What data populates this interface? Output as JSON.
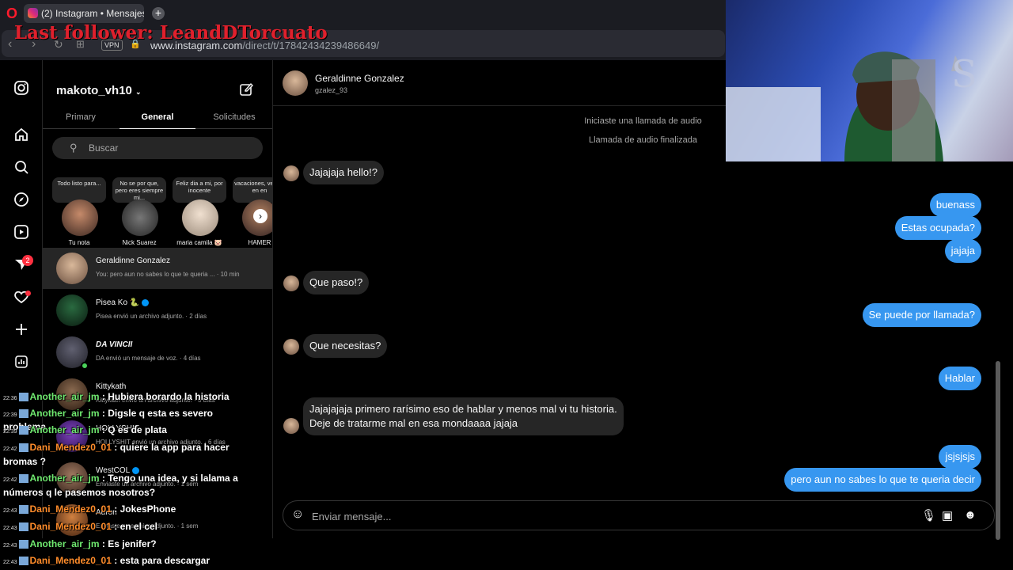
{
  "browser": {
    "tab_title": "(2) Instagram • Mensajes",
    "new_tab": "+",
    "vpn": "VPN",
    "url_host": "www.instagram.com",
    "url_path": "/direct/t/17842434239486649/",
    "opera": "O"
  },
  "overlay": {
    "last_follower": "Last follower: LeandDTorcuato"
  },
  "sidebar": {
    "notifications_badge": "2"
  },
  "inbox": {
    "username": "makoto_vh10",
    "tabs": [
      "Primary",
      "General",
      "Solicitudes"
    ],
    "search_placeholder": "Buscar",
    "notes": [
      {
        "text": "Todo listo para...",
        "name": "Tu nota"
      },
      {
        "text": "No se por que, pero eres siempre mi...",
        "name": "Nick Suarez"
      },
      {
        "text": "Feliz dia a mi, por inocente",
        "name": "maria camila 🐷"
      },
      {
        "text": "vacaciones, vemos en en",
        "name": "HAMER"
      }
    ],
    "conversations": [
      {
        "name": "Geraldinne Gonzalez",
        "preview": "You: pero aun no sabes lo que te queria ... · 10 min"
      },
      {
        "name": "Pisea Ko 🐍",
        "preview": "Pisea envió un archivo adjunto. · 2 días"
      },
      {
        "name": "DA VINCII",
        "preview": "DA envió un mensaje de voz. · 4 días"
      },
      {
        "name": "Kittykath",
        "preview": "Kittykath envió un archivo adjunto. · 5 días"
      },
      {
        "name": "HOLLYSHIT",
        "preview": "HOLLYSHIT envió un archivo adjunto. · 6 días"
      },
      {
        "name": "WestCOL",
        "preview": "Enviaste un archivo adjunto. · 1 sem"
      },
      {
        "name": "Auron",
        "preview": "Enviaste un archivo adjunto. · 1 sem"
      }
    ]
  },
  "chat": {
    "contact_name": "Geraldinne Gonzalez",
    "contact_handle": "gzalez_93",
    "system": [
      "Iniciaste una llamada de audio",
      "Llamada de audio finalizada"
    ],
    "messages": [
      {
        "dir": "recv",
        "text": "Jajajaja hello!?"
      },
      {
        "dir": "sent",
        "text": "buenass"
      },
      {
        "dir": "sent",
        "text": "Estas ocupada?"
      },
      {
        "dir": "sent",
        "text": "jajaja"
      },
      {
        "dir": "recv",
        "text": "Que paso!?"
      },
      {
        "dir": "sent",
        "text": "Se puede por llamada?"
      },
      {
        "dir": "recv",
        "text": "Que necesitas?"
      },
      {
        "dir": "sent",
        "text": "Hablar"
      },
      {
        "dir": "recv",
        "text": "Jajajajaja primero rarísimo eso de hablar y menos mal vi tu historia."
      },
      {
        "dir": "recv",
        "text": "Deje de tratarme mal en esa mondaaaa jajaja"
      },
      {
        "dir": "sent",
        "text": "jsjsjsjs"
      },
      {
        "dir": "sent",
        "text": "pero aun no sabes lo que te queria decir"
      }
    ],
    "composer_placeholder": "Enviar mensaje..."
  },
  "stream_chat": [
    {
      "time": "22:36",
      "user": "Another_air_jm",
      "text": ": Hubiera borardo la historia",
      "color": "green"
    },
    {
      "time": "22:39",
      "user": "Another_air_jm",
      "text": ": Digsle q esta es severo problema",
      "color": "green"
    },
    {
      "time": "22:39",
      "user": "Another_air_jm",
      "text": ": Q es de plata",
      "color": "green"
    },
    {
      "time": "22:42",
      "user": "Dani_Mendez0_01",
      "text": ": quiere la app para hacer",
      "color": "orange"
    },
    {
      "time": "",
      "user": "",
      "text": "bromas ?",
      "color": "none"
    },
    {
      "time": "22:42",
      "user": "Another_air_jm",
      "text": ": Tengo una idea, y si lalama a",
      "color": "green"
    },
    {
      "time": "",
      "user": "",
      "text": "números q le pasemos nosotros?",
      "color": "none"
    },
    {
      "time": "22:43",
      "user": "Dani_Mendez0_01",
      "text": ": JokesPhone",
      "color": "orange"
    },
    {
      "time": "22:43",
      "user": "Dani_Mendez0_01",
      "text": ": en el cel",
      "color": "orange"
    },
    {
      "time": "22:43",
      "user": "Another_air_jm",
      "text": ": Es jenifer?",
      "color": "green"
    },
    {
      "time": "22:43",
      "user": "Dani_Mendez0_01",
      "text": ": esta para descargar",
      "color": "orange"
    }
  ]
}
